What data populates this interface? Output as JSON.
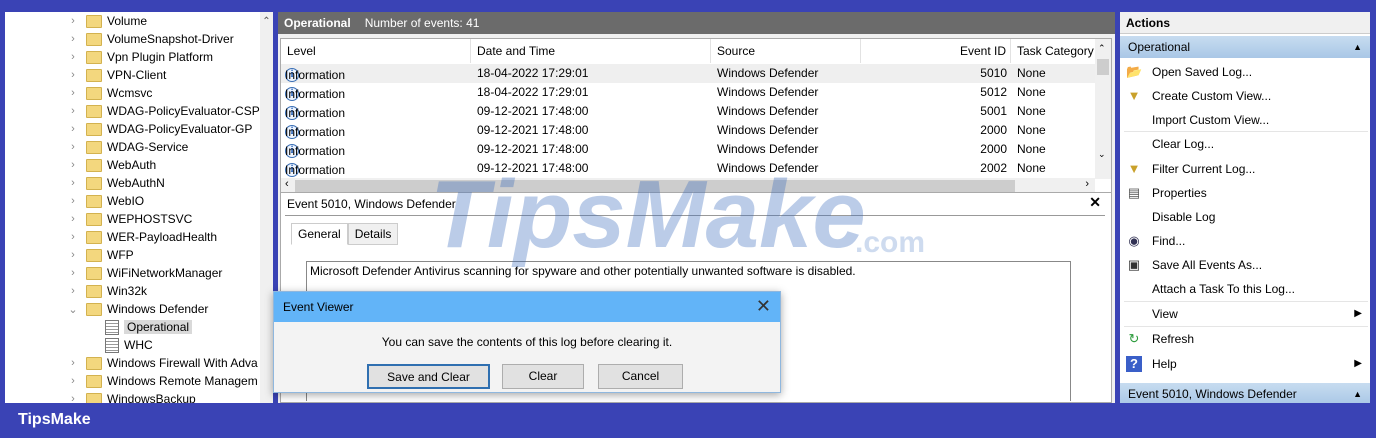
{
  "tree": {
    "items": [
      {
        "label": "Volume",
        "type": "folder"
      },
      {
        "label": "VolumeSnapshot-Driver",
        "type": "folder"
      },
      {
        "label": "Vpn Plugin Platform",
        "type": "folder"
      },
      {
        "label": "VPN-Client",
        "type": "folder"
      },
      {
        "label": "Wcmsvc",
        "type": "folder"
      },
      {
        "label": "WDAG-PolicyEvaluator-CSP",
        "type": "folder"
      },
      {
        "label": "WDAG-PolicyEvaluator-GP",
        "type": "folder"
      },
      {
        "label": "WDAG-Service",
        "type": "folder"
      },
      {
        "label": "WebAuth",
        "type": "folder"
      },
      {
        "label": "WebAuthN",
        "type": "folder"
      },
      {
        "label": "WebIO",
        "type": "folder"
      },
      {
        "label": "WEPHOSTSVC",
        "type": "folder"
      },
      {
        "label": "WER-PayloadHealth",
        "type": "folder"
      },
      {
        "label": "WFP",
        "type": "folder"
      },
      {
        "label": "WiFiNetworkManager",
        "type": "folder"
      },
      {
        "label": "Win32k",
        "type": "folder"
      },
      {
        "label": "Windows Defender",
        "type": "open-folder"
      },
      {
        "label": "Operational",
        "type": "log-selected"
      },
      {
        "label": "WHC",
        "type": "log"
      },
      {
        "label": "Windows Firewall With Adva",
        "type": "folder"
      },
      {
        "label": "Windows Remote Managem",
        "type": "folder"
      },
      {
        "label": "WindowsBackup",
        "type": "folder"
      }
    ]
  },
  "header": {
    "title": "Operational",
    "count": "Number of events: 41"
  },
  "table": {
    "columns": [
      "Level",
      "Date and Time",
      "Source",
      "Event ID",
      "Task Category"
    ],
    "rows": [
      [
        "Information",
        "18-04-2022 17:29:01",
        "Windows Defender",
        "5010",
        "None"
      ],
      [
        "Information",
        "18-04-2022 17:29:01",
        "Windows Defender",
        "5012",
        "None"
      ],
      [
        "Information",
        "09-12-2021 17:48:00",
        "Windows Defender",
        "5001",
        "None"
      ],
      [
        "Information",
        "09-12-2021 17:48:00",
        "Windows Defender",
        "2000",
        "None"
      ],
      [
        "Information",
        "09-12-2021 17:48:00",
        "Windows Defender",
        "2000",
        "None"
      ],
      [
        "Information",
        "09-12-2021 17:48:00",
        "Windows Defender",
        "2002",
        "None"
      ]
    ]
  },
  "detail": {
    "title": "Event 5010, Windows Defender",
    "tabs": [
      "General",
      "Details"
    ],
    "description": "Microsoft Defender Antivirus scanning for spyware and other potentially unwanted software is disabled."
  },
  "dialog": {
    "title": "Event Viewer",
    "message": "You can save the contents of this log before clearing it.",
    "buttons": [
      "Save and Clear",
      "Clear",
      "Cancel"
    ]
  },
  "actions": {
    "title": "Actions",
    "section1": "Operational",
    "items": [
      {
        "label": "Open Saved Log...",
        "icon": "open-folder-icon"
      },
      {
        "label": "Create Custom View...",
        "icon": "filter-icon"
      },
      {
        "label": "Import Custom View...",
        "icon": ""
      },
      {
        "label": "Clear Log...",
        "icon": ""
      },
      {
        "label": "Filter Current Log...",
        "icon": "filter-icon"
      },
      {
        "label": "Properties",
        "icon": "properties-icon"
      },
      {
        "label": "Disable Log",
        "icon": ""
      },
      {
        "label": "Find...",
        "icon": "binoculars-icon"
      },
      {
        "label": "Save All Events As...",
        "icon": "save-icon"
      },
      {
        "label": "Attach a Task To this Log...",
        "icon": ""
      },
      {
        "label": "View",
        "icon": ""
      },
      {
        "label": "Refresh",
        "icon": "refresh-icon"
      },
      {
        "label": "Help",
        "icon": "help-icon"
      }
    ],
    "section2": "Event 5010, Windows Defender"
  },
  "brand": "TipsMake",
  "watermark": "TipsMake",
  "watermark_suffix": ".com"
}
